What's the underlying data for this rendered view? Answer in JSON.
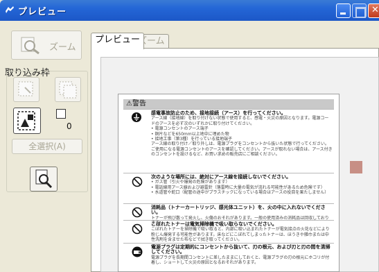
{
  "window": {
    "title": "プレビュー"
  },
  "left_panel": {
    "zoom_label": "ズーム",
    "group_label": "取り込み枠",
    "frame_count": "0",
    "select_all_label": "全選択(A)"
  },
  "tabs": [
    {
      "label": "プレビュー",
      "active": true
    },
    {
      "label": "ズーム",
      "active": false
    }
  ],
  "document": {
    "warning_label": "⚠警告",
    "rows": [
      {
        "icon": "ground-icon",
        "title": "感電事故防止のため、接地接続（アース）を行ってください。",
        "body": "アース線（接地線）を取り付けない状態で使用すると、感電・火災の原因となります。電源コードのアースを必ず次のいずれかに取り付けてください。\n• 電源コンセントのアース端子\n• 銅片などを650mm以上地中に埋めた物\n• 接地工事（第3種）を行っている接地端子\nアース線の取り付け／取り外しは、電源プラグをコンセントから抜いた状態で行ってください。ご使用になる電源コンセントのアースを確認してください。アースが取れない場合は、アース付きのコンセントを設けるなど、お買い求めの販売店にご相談ください。"
      },
      {
        "icon": "prohibited-icon",
        "title": "次のような場所には、絶対にアース線を接続しないでください。",
        "body": "• ガス管（引火や爆発の危険があります）\n• 電話線用アース線および避雷針（落雷時に大量の電気が流れる可能性があるため危険です）\n• 水道管や蛇口（配管の途中がプラスチックになっている場合はアースの役目を果たしません）"
      },
      {
        "icon": "prohibited-icon",
        "title": "消耗品（トナーカートリッジ、感光体ユニット）を、火の中に入れないでください。",
        "body": "トナーが飛び散って発火し、火傷のおそれがあります。一般の使用済みの消耗品は回収しております。"
      },
      {
        "icon": "prohibited-icon",
        "title": "こぼれたトナーは電気掃除機で吸い取らないでください。",
        "body": "こぼれたトナーを掃除機で吸い取ると、内部に吸い込まれたトナーが電気接点の火花などにより粉じん爆発する可能性があります。床などにこぼれてしまったトナーは、ほうきや雑巾または中性洗剤を含ませた布などで拭き取ってください。"
      },
      {
        "icon": "unplug-icon",
        "title": "電源プラグは定期的にコンセントから抜いて、刃の根元、および刃と刃の間を清掃してください。",
        "body": "電源プラグを長期間コンセントに差したままにしておくと、電源プラグの刃の根元にホコリが付着し、ショートして火災の原因となるおそれがあります。"
      }
    ]
  }
}
